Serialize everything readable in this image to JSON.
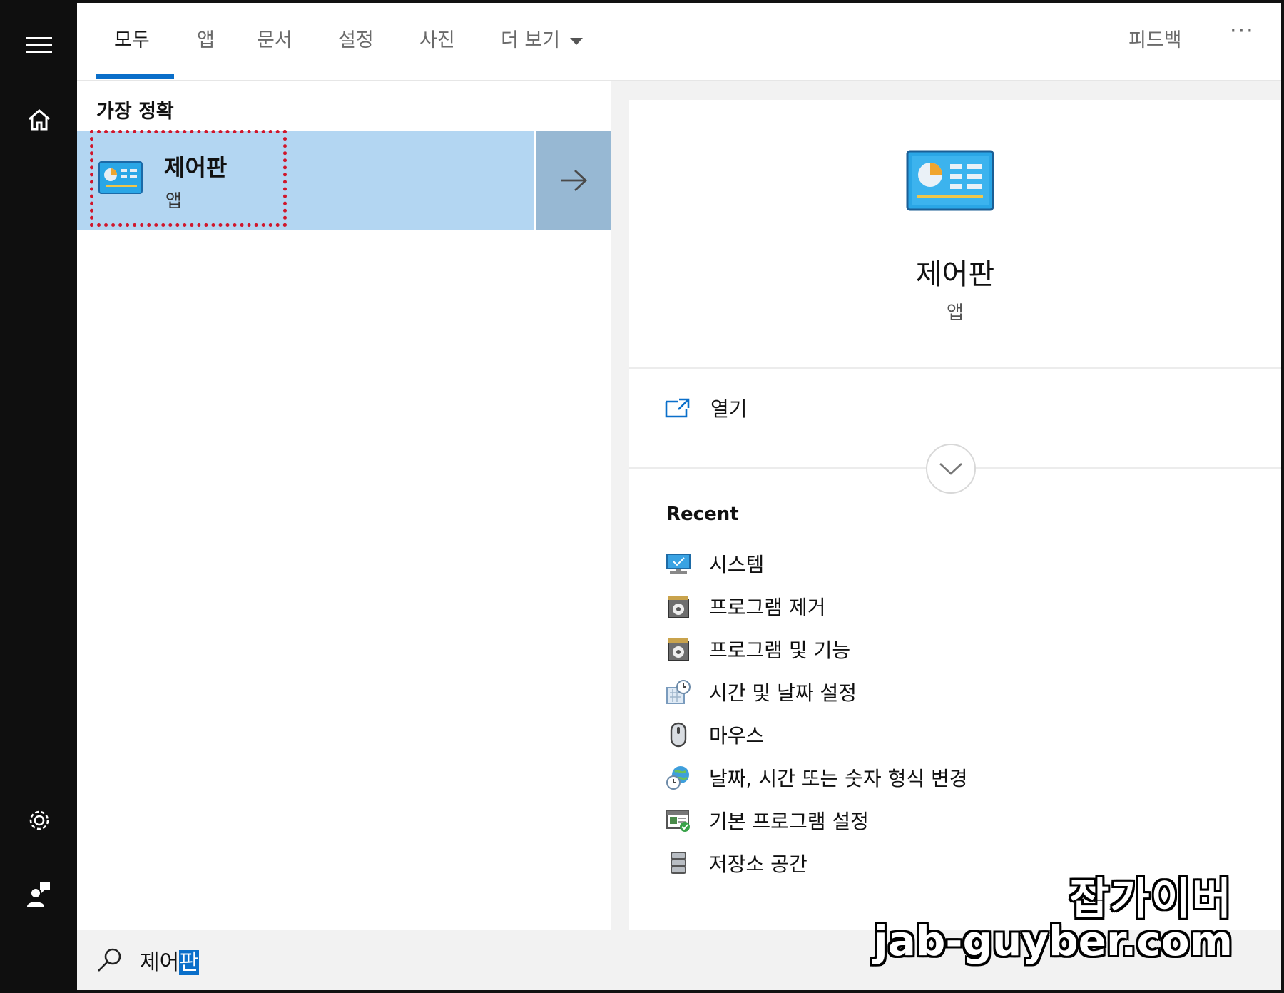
{
  "tabs": [
    {
      "label": "모두"
    },
    {
      "label": "앱"
    },
    {
      "label": "문서"
    },
    {
      "label": "설정"
    },
    {
      "label": "사진"
    },
    {
      "label": "더 보기"
    }
  ],
  "header": {
    "feedback_label": "피드백",
    "more_label": "···"
  },
  "results": {
    "heading": "가장 정확",
    "best_match": {
      "title": "제어판",
      "subtitle": "앱"
    }
  },
  "detail": {
    "title": "제어판",
    "subtitle": "앱",
    "open_label": "열기",
    "recent_heading": "Recent",
    "recent_items": [
      {
        "label": "시스템",
        "icon": "monitor-icon"
      },
      {
        "label": "프로그램 제거",
        "icon": "program-box-icon"
      },
      {
        "label": "프로그램 및 기능",
        "icon": "program-box-icon"
      },
      {
        "label": "시간 및 날짜 설정",
        "icon": "calendar-clock-icon"
      },
      {
        "label": "마우스",
        "icon": "mouse-icon"
      },
      {
        "label": "날짜, 시간 또는 숫자 형식 변경",
        "icon": "globe-clock-icon"
      },
      {
        "label": "기본 프로그램 설정",
        "icon": "default-programs-icon"
      },
      {
        "label": "저장소 공간",
        "icon": "storage-icon"
      }
    ]
  },
  "search": {
    "typed": "제어",
    "selected": "판"
  },
  "watermark": {
    "line1": "잡가이버",
    "line2": "jab-guyber.com"
  },
  "colors": {
    "accent": "#0a6fca",
    "highlight": "#b3d6f2",
    "outline": "#d0162b"
  }
}
